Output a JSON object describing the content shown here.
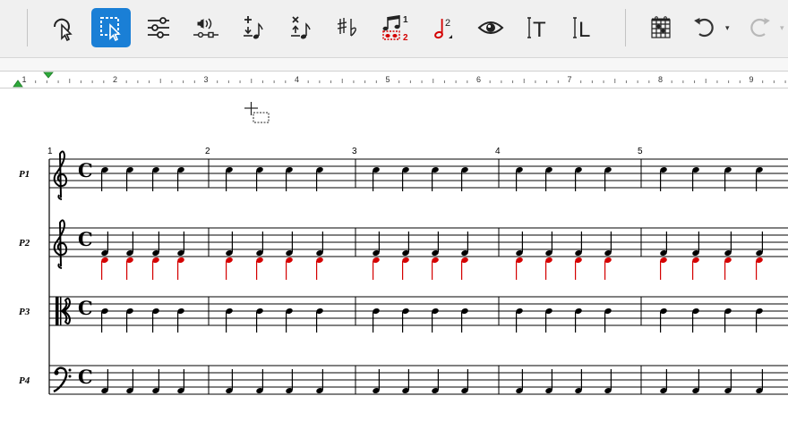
{
  "toolbar": {
    "buttons": [
      {
        "name": "lasso-select-button",
        "icon": "lasso-cursor-icon",
        "active": false
      },
      {
        "name": "marquee-select-button",
        "icon": "marquee-cursor-icon",
        "active": true
      },
      {
        "name": "mixer-button",
        "icon": "sliders-icon",
        "active": false
      },
      {
        "name": "playback-button",
        "icon": "speaker-track-icon",
        "active": false
      },
      {
        "name": "add-note-button",
        "icon": "add-note-icon",
        "active": false
      },
      {
        "name": "delete-note-button",
        "icon": "delete-note-icon",
        "active": false
      },
      {
        "name": "accidentals-button",
        "icon": "sharp-flat-icon",
        "active": false
      },
      {
        "name": "tuplet-voices-button",
        "icon": "voices-icon",
        "active": false
      },
      {
        "name": "note-duration-button",
        "icon": "half-note-icon",
        "active": false
      },
      {
        "name": "view-button",
        "icon": "eye-icon",
        "active": false
      },
      {
        "name": "text-insert-button",
        "icon": "text-cursor-icon",
        "active": false
      },
      {
        "name": "lyrics-insert-button",
        "icon": "lyrics-cursor-icon",
        "active": false
      },
      {
        "name": "chord-diagram-button",
        "icon": "chord-grid-icon",
        "active": false
      },
      {
        "name": "undo-button",
        "icon": "undo-icon",
        "active": false
      },
      {
        "name": "redo-button",
        "icon": "redo-icon",
        "active": false
      }
    ],
    "voice_digits": [
      "1",
      "2"
    ],
    "duration_digit": "2",
    "text_tool_letter": "T",
    "lyrics_tool_letter": "L",
    "dropdown_glyph": "▾"
  },
  "colors": {
    "accent": "#1a7fd6",
    "voice2": "#d40000",
    "indent_marker": "#2eaa3a",
    "ink": "#000000"
  },
  "ruler": {
    "labels": [
      "1",
      "2",
      "3",
      "4",
      "5",
      "6",
      "7",
      "8",
      "9"
    ]
  },
  "score": {
    "staves": [
      {
        "label": "P1",
        "clef": "treble",
        "time": "C"
      },
      {
        "label": "P2",
        "clef": "treble",
        "time": "C"
      },
      {
        "label": "P3",
        "clef": "alto",
        "time": "C"
      },
      {
        "label": "P4",
        "clef": "bass",
        "time": "C"
      }
    ],
    "measure_numbers": [
      "1",
      "2",
      "3",
      "4",
      "5"
    ],
    "notes_per_measure": 4
  }
}
